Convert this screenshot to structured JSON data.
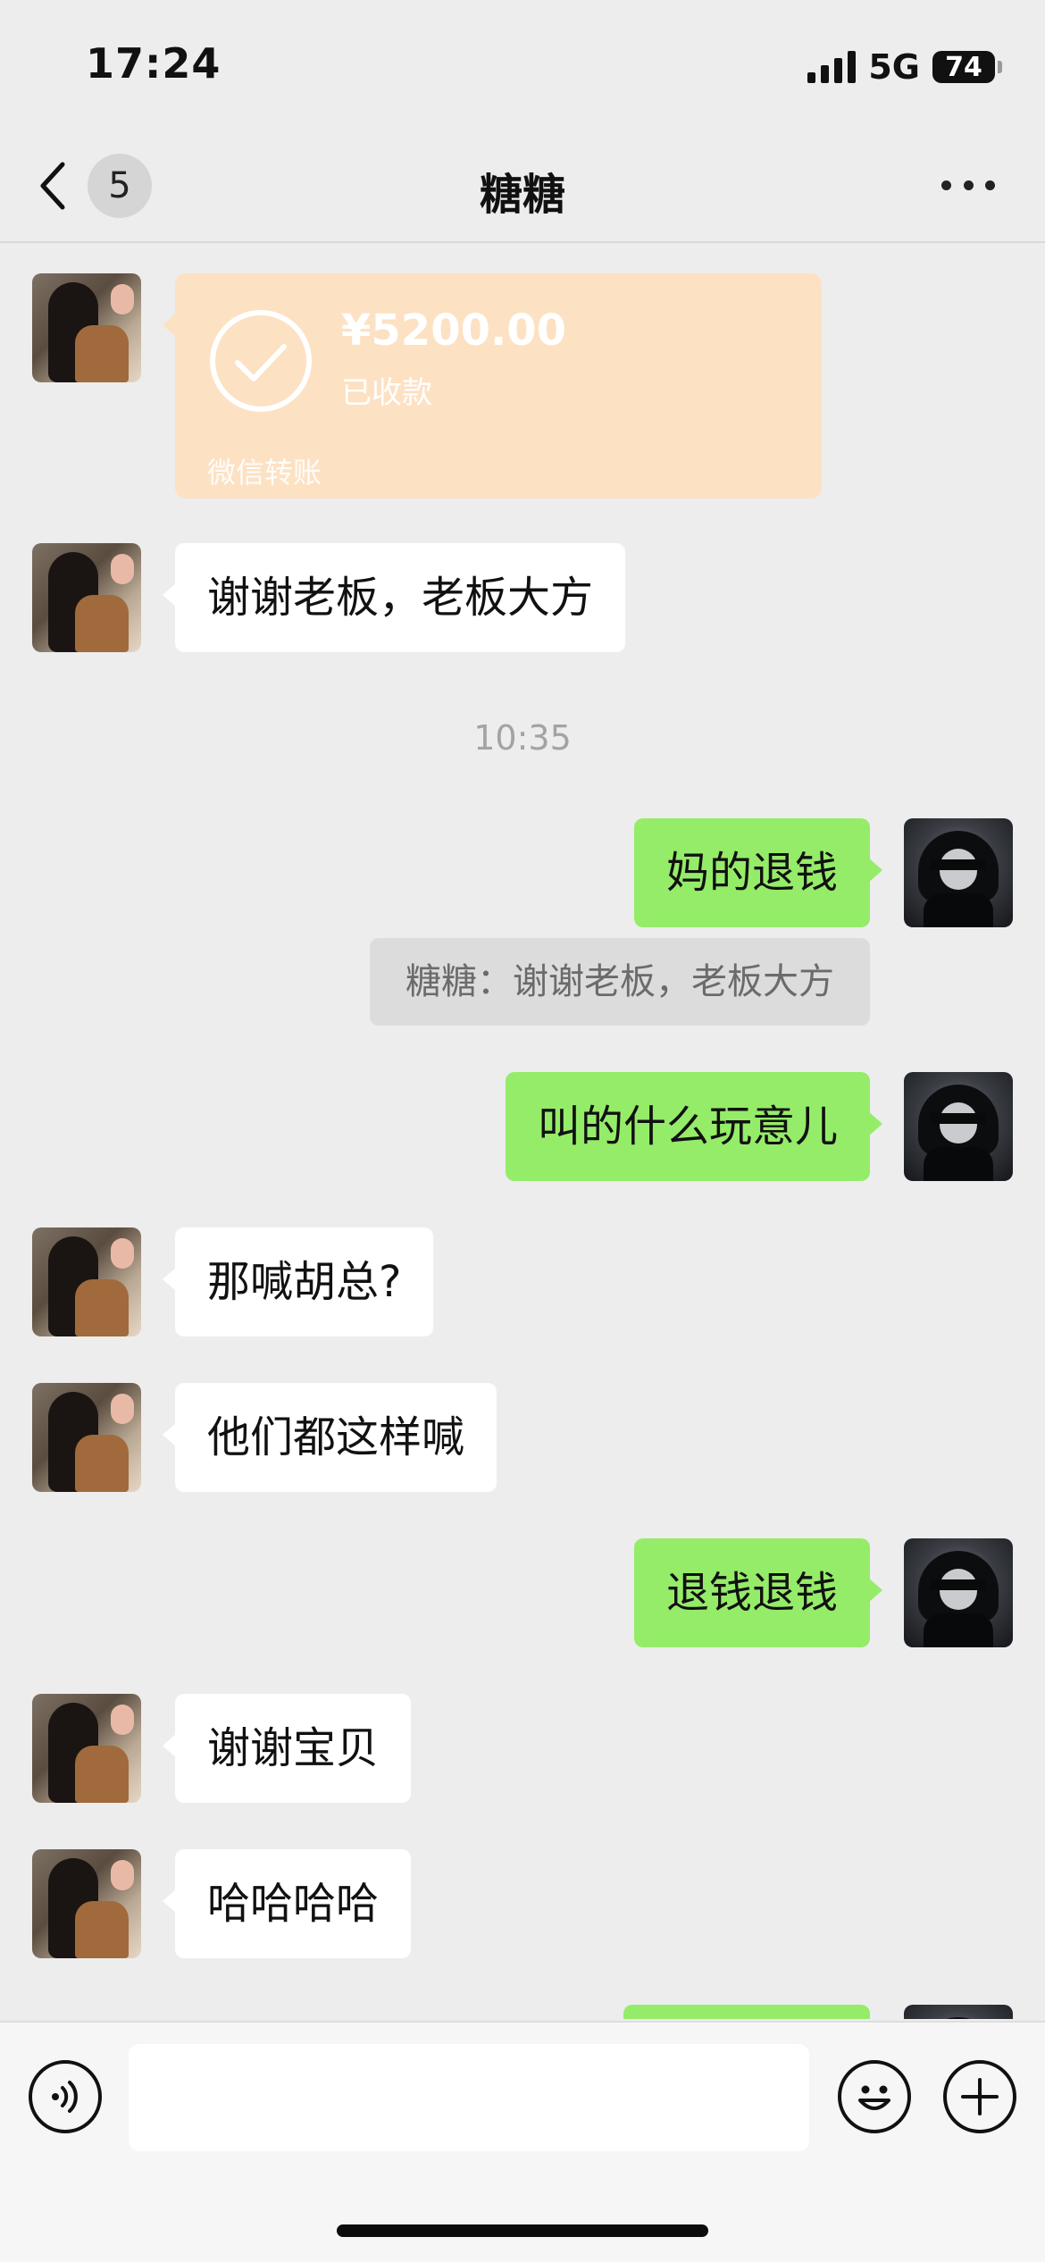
{
  "status_bar": {
    "time": "17:24",
    "network": "5G",
    "battery": "74"
  },
  "nav": {
    "unread_count": "5",
    "title": "糖糖"
  },
  "messages": {
    "transfer": {
      "amount": "¥5200.00",
      "status": "已收款",
      "footer": "微信转账"
    },
    "m1": "谢谢老板，老板大方",
    "timestamp": "10:35",
    "m2": "妈的退钱",
    "quote": "糖糖：谢谢老板，老板大方",
    "m3": "叫的什么玩意儿",
    "m4": "那喊胡总?",
    "m5": "他们都这样喊",
    "m6": "退钱退钱",
    "m7": "谢谢宝贝",
    "m8": "哈哈哈哈"
  },
  "colors": {
    "outgoing_bubble": "#95ec69",
    "incoming_bubble": "#ffffff",
    "transfer_card": "#fde1c3",
    "background": "#ededed"
  },
  "icons": [
    "back-chevron-icon",
    "more-icon",
    "check-circle-icon",
    "voice-icon",
    "emoji-icon",
    "plus-icon"
  ]
}
